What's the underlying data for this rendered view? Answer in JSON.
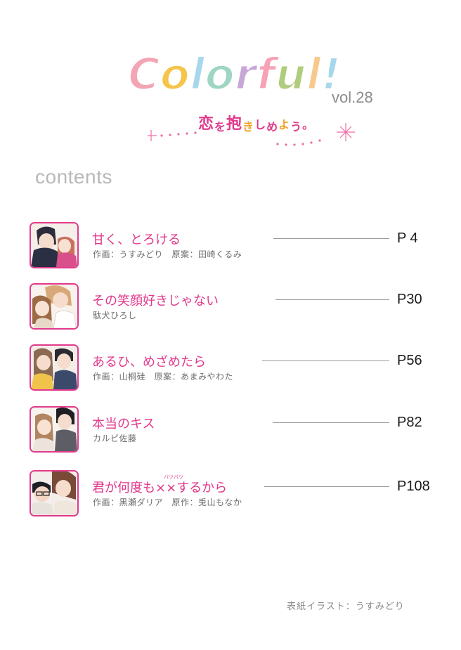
{
  "header": {
    "logo_letters": [
      {
        "ch": "C",
        "color": "#f3a5b4"
      },
      {
        "ch": "o",
        "color": "#f5c44a"
      },
      {
        "ch": "l",
        "color": "#a7d7ec"
      },
      {
        "ch": "o",
        "color": "#9fd5c4"
      },
      {
        "ch": "r",
        "color": "#c8a7d8"
      },
      {
        "ch": "f",
        "color": "#f5a3b5"
      },
      {
        "ch": "u",
        "color": "#b0cc7d"
      },
      {
        "ch": "l",
        "color": "#f7c98c"
      },
      {
        "ch": "!",
        "color": "#a7d7ec"
      }
    ],
    "volume": "vol.28",
    "tagline": [
      {
        "ch": "恋",
        "color": "#e0398b"
      },
      {
        "ch": "を",
        "color": "#e0398b"
      },
      {
        "ch": "抱",
        "color": "#e0398b"
      },
      {
        "ch": "き",
        "color": "#f3a028"
      },
      {
        "ch": "し",
        "color": "#e0398b"
      },
      {
        "ch": "め",
        "color": "#e0398b"
      },
      {
        "ch": "よ",
        "color": "#f3a028"
      },
      {
        "ch": "う",
        "color": "#e0398b"
      },
      {
        "ch": "。",
        "color": "#e0398b"
      }
    ]
  },
  "contents_heading": "contents",
  "toc": [
    {
      "title": "甘く、とろける",
      "credit": "作画：うすみどり　原案：田崎くるみ",
      "page": "P 4"
    },
    {
      "title": "その笑顔好きじゃない",
      "credit": "駄犬ひろし",
      "page": "P30"
    },
    {
      "title": "あるひ、めざめたら",
      "credit": "作画：山桐硅　原案：あまみやわた",
      "page": "P56"
    },
    {
      "title": "本当のキス",
      "credit": "カルビ佐藤",
      "page": "P82"
    },
    {
      "title": "君が何度も××するから",
      "ruby": "バツバツ",
      "credit": "作画：黒瀬ダリア　原作：兎山もなか",
      "page": "P108"
    }
  ],
  "cover_credit": "表紙イラスト：うすみどり",
  "colors": {
    "accent": "#e0398b",
    "page_number": "#1a1a1a",
    "credit": "#6e6e6e"
  }
}
